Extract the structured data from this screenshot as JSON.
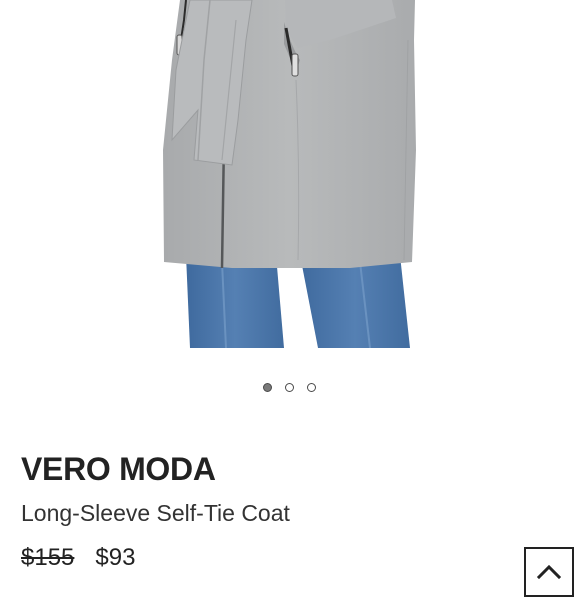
{
  "product": {
    "brand": "VERO MODA",
    "name": "Long-Sleeve Self-Tie Coat",
    "original_price": "$155",
    "sale_price": "$93"
  },
  "carousel": {
    "total_images": 3,
    "active_index": 0
  },
  "icons": {
    "scroll_top": "chevron-up-icon"
  },
  "colors": {
    "coat": "#b3b5b7",
    "jeans": "#4a74a8",
    "text": "#222222"
  }
}
